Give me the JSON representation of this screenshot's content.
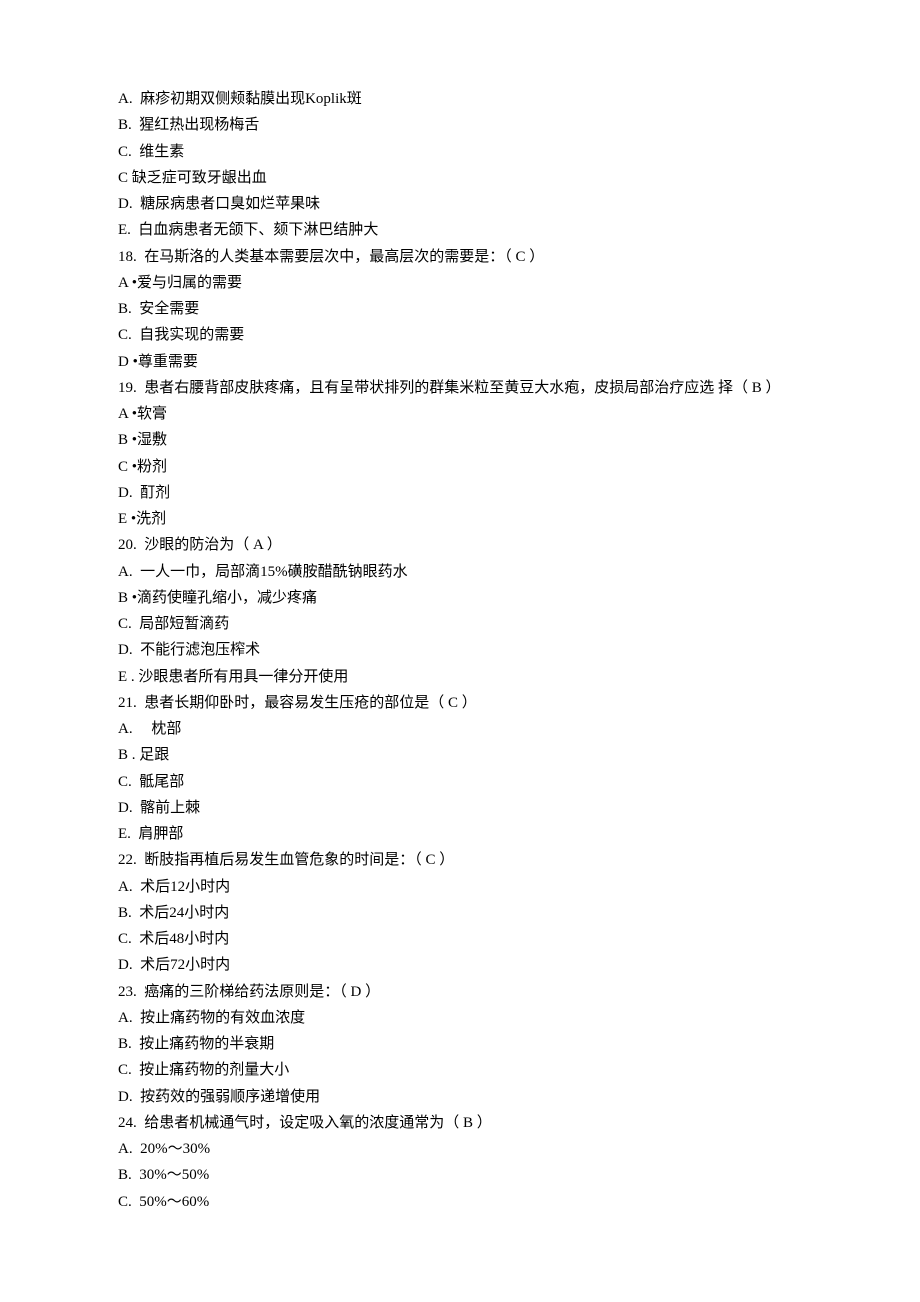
{
  "lines": [
    "A.  麻疹初期双侧颊黏膜出现Koplik斑",
    "B.  猩红热出现杨梅舌",
    "C.  维生素",
    "C 缺乏症可致牙龈出血",
    "D.  糖尿病患者口臭如烂苹果味",
    "E.  白血病患者无颌下、颏下淋巴结肿大",
    "18.  在马斯洛的人类基本需要层次中，最高层次的需要是：（ C ）",
    "A •爱与归属的需要",
    "B.  安全需要",
    "C.  自我实现的需要",
    "D •尊重需要",
    "19.  患者右腰背部皮肤疼痛，且有呈带状排列的群集米粒至黄豆大水疱，皮损局部治疗应选 择（ B ）",
    "A •软膏",
    "B •湿敷",
    "C •粉剂",
    "D.  酊剂",
    "E •洗剂",
    "20.  沙眼的防治为（ A ）",
    "A.  一人一巾，局部滴15%磺胺醋酰钠眼药水",
    "B •滴药使瞳孔缩小，减少疼痛",
    "C.  局部短暂滴药",
    "D.  不能行滤泡压榨术",
    "E . 沙眼患者所有用具一律分开使用",
    "21.  患者长期仰卧时，最容易发生压疮的部位是（ C ）",
    "A.     枕部",
    "B . 足跟",
    "C.  骶尾部",
    "D.  髂前上棘",
    "E.  肩胛部",
    "22.  断肢指再植后易发生血管危象的时间是：（ C ）",
    "A.  术后12小时内",
    "B.  术后24小时内",
    "C.  术后48小时内",
    "D.  术后72小时内",
    "23.  癌痛的三阶梯给药法原则是：（ D ）",
    "A.  按止痛药物的有效血浓度",
    "B.  按止痛药物的半衰期",
    "C.  按止痛药物的剂量大小",
    "D.  按药效的强弱顺序递增使用",
    "24.  给患者机械通气时，设定吸入氧的浓度通常为（ B ）",
    "A.  20%〜30%",
    "B.  30%〜50%",
    "C.  50%〜60%"
  ]
}
